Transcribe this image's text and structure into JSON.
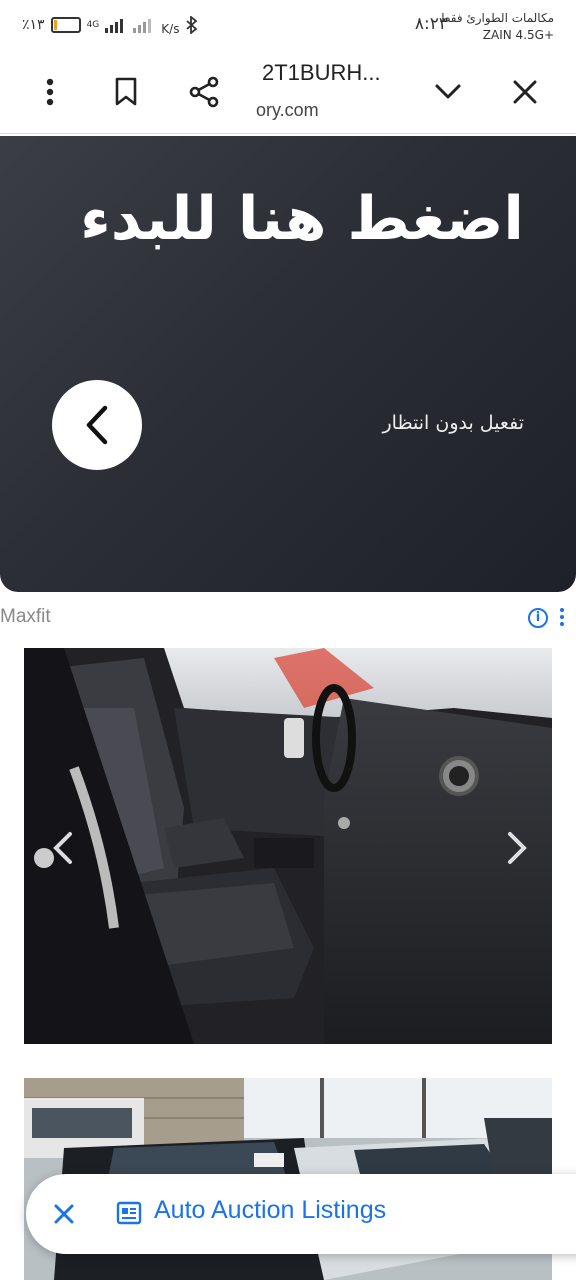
{
  "status_bar": {
    "battery_text": "٪١٣",
    "network_type": "4G",
    "speed_unit": "K/s",
    "clock": "٨:٢٣",
    "carrier_line1": "مكالمات الطوارئ فقط",
    "carrier_line2": "ZAIN 4.5G+",
    "battery_level": 0.13,
    "icons": [
      "battery-icon",
      "signal-icon",
      "bluetooth-icon"
    ]
  },
  "toolbar": {
    "title": "2T1BURH...",
    "url": "ory.com",
    "icons": [
      "more-vert-icon",
      "bookmark-icon",
      "share-icon",
      "chevron-down-icon",
      "close-icon"
    ]
  },
  "ad": {
    "headline": "اضغط هنا للبدء",
    "subtext": "تفعيل بدون انتظار",
    "sponsor_label": "Maxfit",
    "info_glyph": "i",
    "icons": [
      "chevron-left-icon",
      "info-icon"
    ]
  },
  "gallery": {
    "photos": [
      "car-interior-photo",
      "car-exterior-photo"
    ],
    "icons": [
      "gallery-prev-icon",
      "gallery-next-icon"
    ]
  },
  "bottom_chip": {
    "label": "Auto Auction Listings",
    "icons": [
      "close-icon",
      "listing-icon"
    ]
  },
  "colors": {
    "accent": "#1a73e8",
    "banner_dark": "#2b2e35"
  }
}
